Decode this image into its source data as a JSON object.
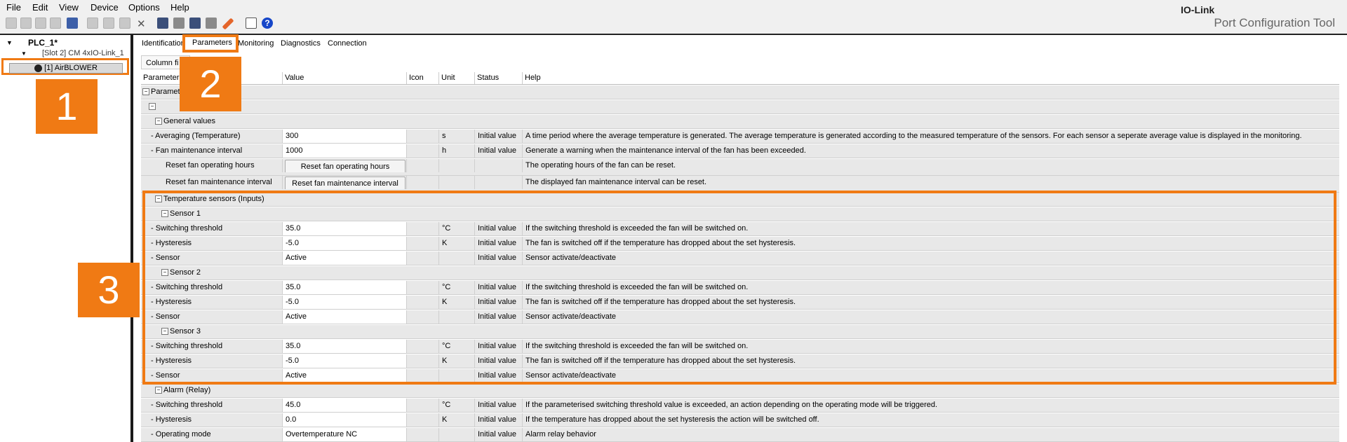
{
  "menu": [
    "File",
    "Edit",
    "View",
    "Device",
    "Options",
    "Help"
  ],
  "brand": {
    "line1": "IO-Link",
    "line2": "Port Configuration Tool"
  },
  "tree": {
    "plc": "PLC_1*",
    "slot": "[Slot 2] CM 4xIO-Link_1",
    "device": "[1] AirBLOWER"
  },
  "tabs": [
    "Identification",
    "Parameters",
    "Monitoring",
    "Diagnostics",
    "Connection"
  ],
  "column_filter": "Column fi",
  "headers": [
    "Parameter",
    "Value",
    "Icon",
    "Unit",
    "Status",
    "Help"
  ],
  "rows": [
    {
      "kind": "group",
      "indent": 0,
      "label": "Parameter"
    },
    {
      "kind": "group",
      "indent": 1,
      "label": ""
    },
    {
      "kind": "group",
      "indent": 2,
      "label": "General values"
    },
    {
      "kind": "param",
      "name": "- Averaging (Temperature)",
      "value": "300",
      "unit": "s",
      "status": "Initial value",
      "help": "A time period where the average temperature is generated. The average temperature is generated according to the measured temperature of the sensors. For each sensor a seperate average value is displayed in the monitoring."
    },
    {
      "kind": "param",
      "name": "- Fan maintenance interval",
      "value": "1000",
      "unit": "h",
      "status": "Initial value",
      "help": "Generate a warning when the maintenance interval of the fan has been exceeded."
    },
    {
      "kind": "button",
      "name": "Reset fan operating hours",
      "button": "Reset fan operating hours",
      "help": "The operating hours of the fan can be reset."
    },
    {
      "kind": "button",
      "name": "Reset fan maintenance interval",
      "button": "Reset fan maintenance interval",
      "help": "The displayed fan maintenance interval can be reset."
    },
    {
      "kind": "group",
      "indent": 2,
      "label": "Temperature sensors (Inputs)"
    },
    {
      "kind": "group",
      "indent": 3,
      "label": "Sensor 1"
    },
    {
      "kind": "param",
      "name": "- Switching threshold",
      "value": "35.0",
      "unit": "°C",
      "status": "Initial value",
      "help": "If the switching threshold is exceeded the fan will be switched on."
    },
    {
      "kind": "param",
      "name": "- Hysteresis",
      "value": "-5.0",
      "unit": "K",
      "status": "Initial value",
      "help": "The fan is switched off if the temperature has dropped about the set hysteresis."
    },
    {
      "kind": "param",
      "name": "- Sensor",
      "value": "Active",
      "unit": "",
      "status": "Initial value",
      "help": "Sensor activate/deactivate"
    },
    {
      "kind": "group",
      "indent": 3,
      "label": "Sensor 2"
    },
    {
      "kind": "param",
      "name": "- Switching threshold",
      "value": "35.0",
      "unit": "°C",
      "status": "Initial value",
      "help": "If the switching threshold is exceeded the fan will be switched on."
    },
    {
      "kind": "param",
      "name": "- Hysteresis",
      "value": "-5.0",
      "unit": "K",
      "status": "Initial value",
      "help": "The fan is switched off if the temperature has dropped about the set hysteresis."
    },
    {
      "kind": "param",
      "name": "- Sensor",
      "value": "Active",
      "unit": "",
      "status": "Initial value",
      "help": "Sensor activate/deactivate"
    },
    {
      "kind": "group",
      "indent": 3,
      "label": "Sensor 3"
    },
    {
      "kind": "param",
      "name": "- Switching threshold",
      "value": "35.0",
      "unit": "°C",
      "status": "Initial value",
      "help": "If the switching threshold is exceeded the fan will be switched on."
    },
    {
      "kind": "param",
      "name": "- Hysteresis",
      "value": "-5.0",
      "unit": "K",
      "status": "Initial value",
      "help": "The fan is switched off if the temperature has dropped about the set hysteresis."
    },
    {
      "kind": "param",
      "name": "- Sensor",
      "value": "Active",
      "unit": "",
      "status": "Initial value",
      "help": "Sensor activate/deactivate"
    },
    {
      "kind": "group",
      "indent": 2,
      "label": "Alarm (Relay)"
    },
    {
      "kind": "param",
      "name": "- Switching threshold",
      "value": "45.0",
      "unit": "°C",
      "status": "Initial value",
      "help": "If the parameterised switching threshold value is exceeded, an action depending on the operating mode will be triggered."
    },
    {
      "kind": "param",
      "name": "- Hysteresis",
      "value": "0.0",
      "unit": "K",
      "status": "Initial value",
      "help": "If the temperature has dropped about the set hysteresis the action will be switched off."
    },
    {
      "kind": "param",
      "name": "- Operating mode",
      "value": "Overtemperature NC",
      "unit": "",
      "status": "Initial value",
      "help": "Alarm relay behavior"
    }
  ],
  "callouts": [
    "1",
    "2",
    "3"
  ],
  "colors": {
    "highlight": "#f07a14"
  }
}
